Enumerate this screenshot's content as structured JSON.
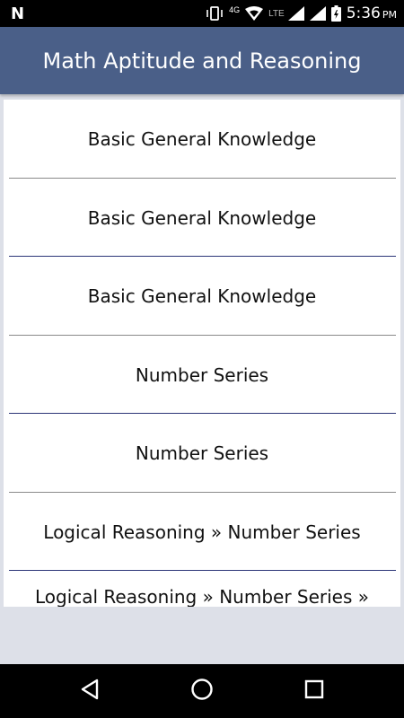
{
  "status_bar": {
    "time": "5:36",
    "ampm": "PM",
    "network_4g": "4G",
    "network_lte": "LTE",
    "icons": [
      "n-notification-icon",
      "vibrate-icon",
      "wifi-icon",
      "signal-icon",
      "signal-icon",
      "battery-charging-icon"
    ]
  },
  "app_bar": {
    "title": "Math Aptitude and Reasoning",
    "background": "#4a5f88"
  },
  "list": {
    "items": [
      {
        "label": "Basic General Knowledge"
      },
      {
        "label": "Basic General Knowledge"
      },
      {
        "label": "Basic General Knowledge"
      },
      {
        "label": "Number Series"
      },
      {
        "label": "Number Series"
      },
      {
        "label": "Logical Reasoning » Number Series"
      },
      {
        "label": "Logical Reasoning » Number Series »"
      }
    ]
  },
  "nav_bar": {
    "icons": [
      "back-icon",
      "home-icon",
      "recents-icon"
    ]
  }
}
